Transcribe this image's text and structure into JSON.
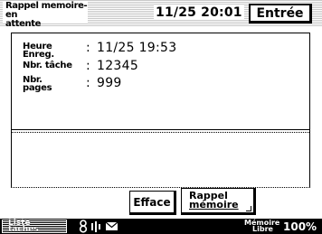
{
  "header": {
    "title_line1": "Rappel memoire-en",
    "title_line2": "attente",
    "datetime": "11/25  20:01",
    "enter_label": "Entrée"
  },
  "info": {
    "rows": [
      {
        "label_line1": "Heure",
        "label_line2": "Enreg.",
        "value": "11/25  19:53"
      },
      {
        "label_line1": "Nbr. tâche",
        "label_line2": "",
        "value": "12345"
      },
      {
        "label_line1": "Nbr.",
        "label_line2": "pages",
        "value": "999"
      }
    ],
    "colon": ":"
  },
  "buttons": {
    "erase_label": "Efface",
    "recall_line1": "Rappel",
    "recall_line2": "mémoire"
  },
  "footer": {
    "list_line1": "Liste",
    "list_line2": "tâches",
    "memory_line1": "Mémoire",
    "memory_line2": "Libre",
    "memory_percent": "100%",
    "icons": [
      "toner-icon",
      "fax-line-icon",
      "mail-icon"
    ]
  }
}
